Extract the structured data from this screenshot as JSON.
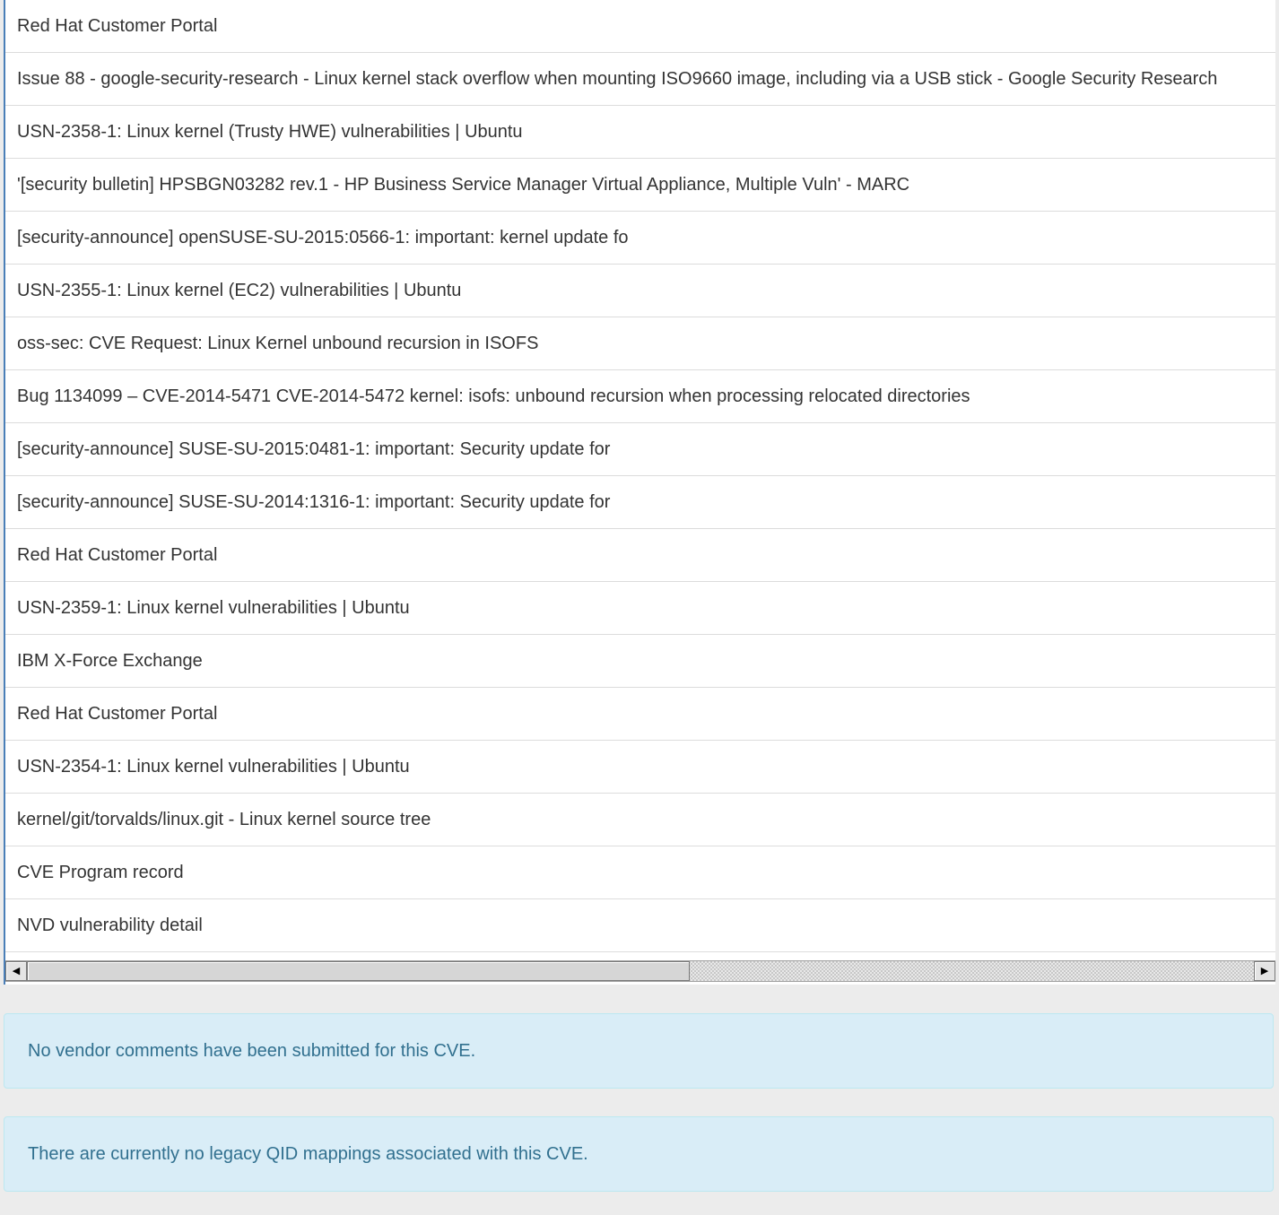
{
  "references": [
    "Red Hat Customer Portal",
    "Issue 88 - google-security-research - Linux kernel stack overflow when mounting ISO9660 image, including via a USB stick - Google Security Research",
    "USN-2358-1: Linux kernel (Trusty HWE) vulnerabilities | Ubuntu",
    "'[security bulletin] HPSBGN03282 rev.1 - HP Business Service Manager Virtual Appliance, Multiple Vuln' - MARC",
    "[security-announce] openSUSE-SU-2015:0566-1: important: kernel update fo",
    "USN-2355-1: Linux kernel (EC2) vulnerabilities | Ubuntu",
    "oss-sec: CVE Request: Linux Kernel unbound recursion in ISOFS",
    "Bug 1134099 – CVE-2014-5471 CVE-2014-5472 kernel: isofs: unbound recursion when processing relocated directories",
    "[security-announce] SUSE-SU-2015:0481-1: important: Security update for",
    "[security-announce] SUSE-SU-2014:1316-1: important: Security update for",
    "Red Hat Customer Portal",
    "USN-2359-1: Linux kernel vulnerabilities | Ubuntu",
    "IBM X-Force Exchange",
    "Red Hat Customer Portal",
    "USN-2354-1: Linux kernel vulnerabilities | Ubuntu",
    "kernel/git/torvalds/linux.git - Linux kernel source tree",
    "CVE Program record",
    "NVD vulnerability detail"
  ],
  "scrollbar": {
    "left_arrow": "◀",
    "right_arrow": "▶",
    "position_fraction": 0.0,
    "visible_fraction": 0.54
  },
  "vendor_comments": {
    "message": "No vendor comments have been submitted for this CVE."
  },
  "qid_mappings": {
    "message": "There are currently no legacy QID mappings associated with this CVE."
  },
  "colors": {
    "panel_border_accent": "#4a7fb8",
    "alert_bg": "#d9edf7",
    "alert_text": "#31708f",
    "page_bg": "#ececec"
  }
}
